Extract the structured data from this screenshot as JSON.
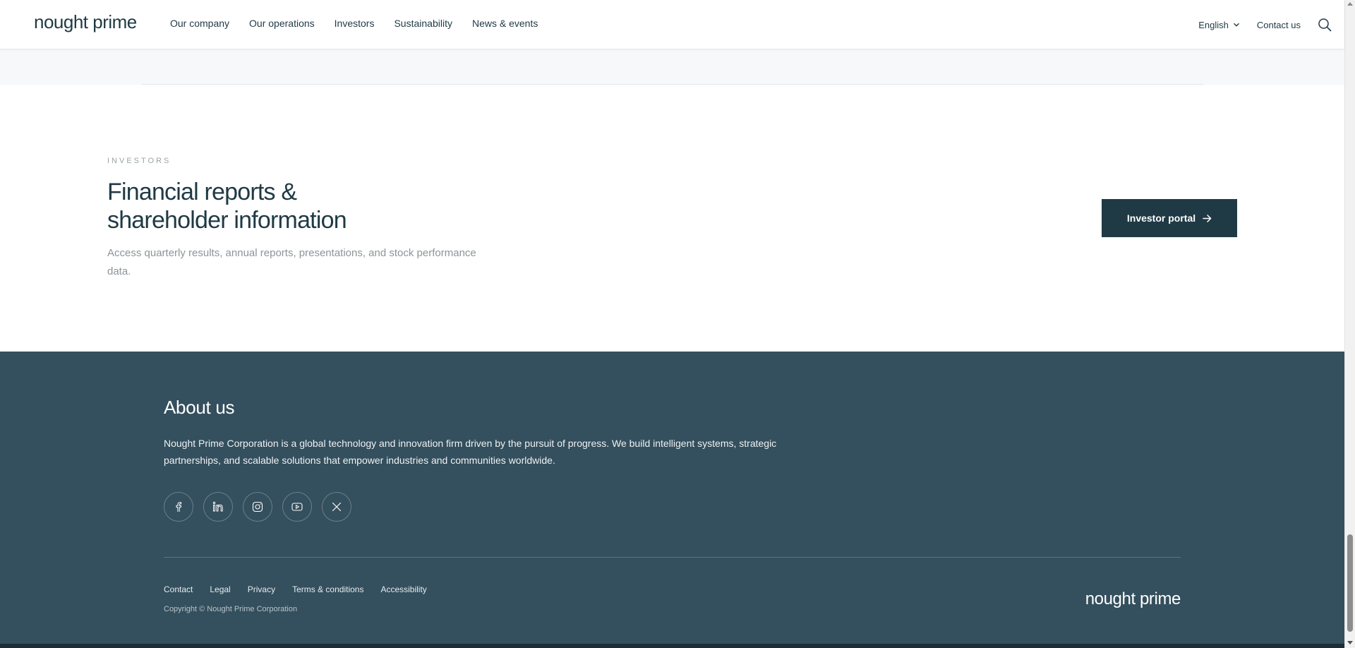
{
  "header": {
    "logo": "nought prime",
    "nav": [
      "Our company",
      "Our operations",
      "Investors",
      "Sustainability",
      "News & events"
    ],
    "language": "English",
    "contact": "Contact us"
  },
  "investors": {
    "eyebrow": "INVESTORS",
    "title_line1": "Financial reports &",
    "title_line2": "shareholder information",
    "description": "Access quarterly results, annual reports, presentations, and stock performance data.",
    "button_label": "Investor portal"
  },
  "footer": {
    "about_title": "About us",
    "about_text": "Nought Prime Corporation is a global technology and innovation firm driven by the pursuit of progress. We build intelligent systems, strategic partnerships, and scalable solutions that empower industries and communities worldwide.",
    "socials": [
      "facebook-icon",
      "linkedin-icon",
      "instagram-icon",
      "youtube-icon",
      "x-icon"
    ],
    "links": [
      "Contact",
      "Legal",
      "Privacy",
      "Terms & conditions",
      "Accessibility"
    ],
    "copyright": "Copyright © Nought Prime Corporation",
    "logo": "nought prime"
  },
  "colors": {
    "primary": "#1f3a45",
    "footer_bg": "#344f5d",
    "gray_band": "#f7f8f9"
  }
}
